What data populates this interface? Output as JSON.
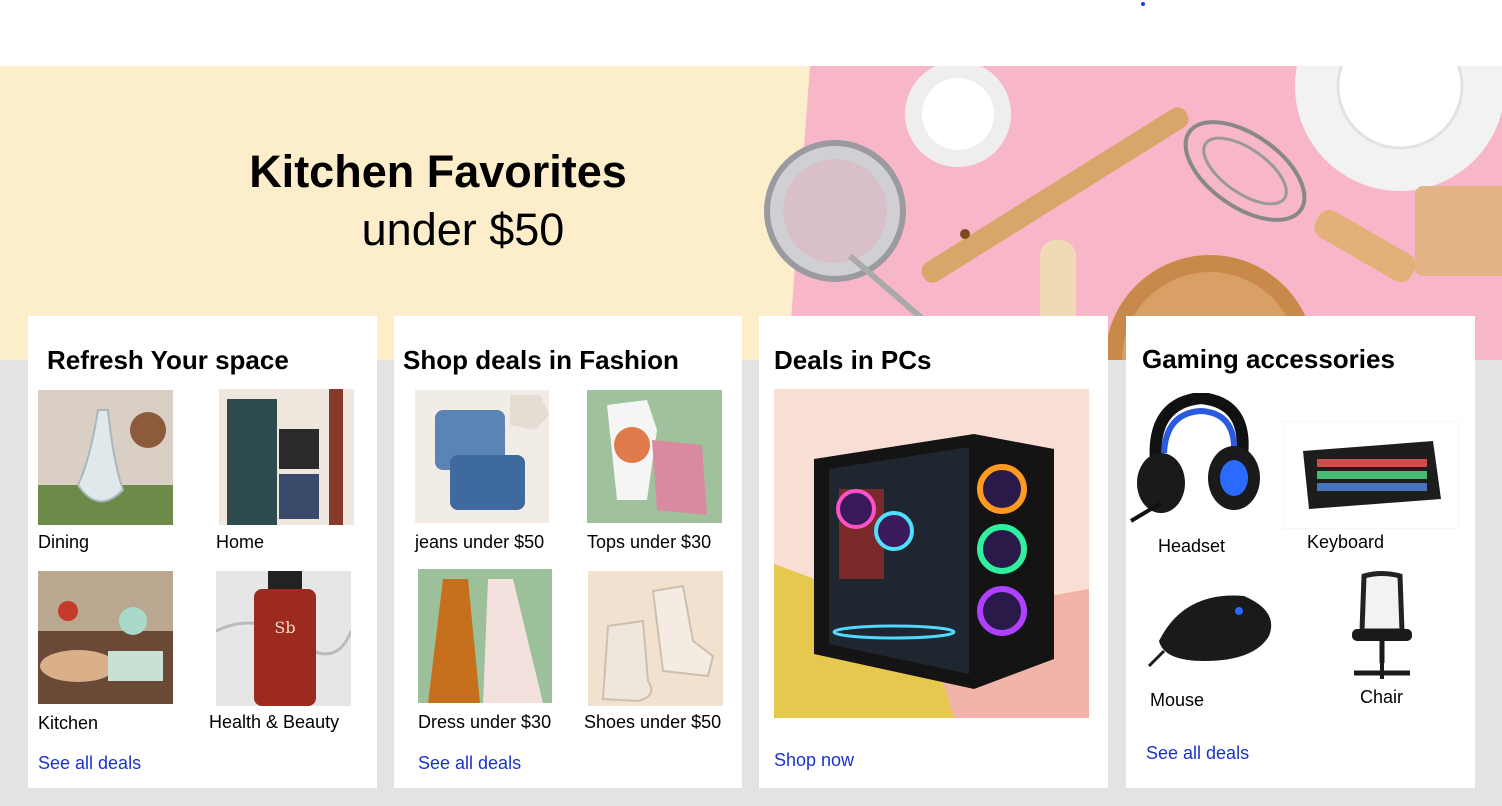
{
  "hero": {
    "title": "Kitchen Favorites",
    "subtitle": "under $50",
    "colors": {
      "left_bg": "#fdeecb",
      "right_bg": "#f7b7c8"
    }
  },
  "cards": {
    "refresh": {
      "title": "Refresh Your space",
      "items": [
        {
          "label": "Dining"
        },
        {
          "label": "Home"
        },
        {
          "label": "Kitchen"
        },
        {
          "label": "Health & Beauty"
        }
      ],
      "link": "See all deals"
    },
    "fashion": {
      "title": "Shop deals in Fashion",
      "items": [
        {
          "label": "jeans under $50"
        },
        {
          "label": "Tops under $30"
        },
        {
          "label": "Dress under  $30"
        },
        {
          "label": "Shoes under $50"
        }
      ],
      "link": "See all deals"
    },
    "pcs": {
      "title": "Deals in PCs",
      "link": "Shop now"
    },
    "gaming": {
      "title": "Gaming accessories",
      "items": [
        {
          "label": "Headset"
        },
        {
          "label": "Keyboard"
        },
        {
          "label": "Mouse"
        },
        {
          "label": "Chair"
        }
      ],
      "link": "See all deals"
    }
  },
  "colors": {
    "link": "#1a33cc",
    "page_bg": "#e3e3e3"
  }
}
